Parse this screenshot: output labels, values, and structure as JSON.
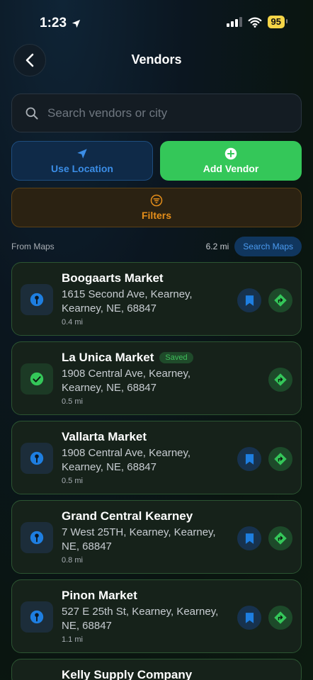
{
  "status": {
    "time": "1:23",
    "battery": "95"
  },
  "header": {
    "title": "Vendors"
  },
  "search": {
    "placeholder": "Search vendors or city"
  },
  "actions": {
    "use_location": "Use Location",
    "add_vendor": "Add Vendor",
    "filters": "Filters"
  },
  "section": {
    "label": "From Maps",
    "distance": "6.2 mi",
    "search_maps": "Search Maps"
  },
  "vendors": [
    {
      "name": "Boogaarts Market",
      "address": "1615 Second Ave, Kearney, Kearney, NE, 68847",
      "distance": "0.4 mi",
      "saved": false
    },
    {
      "name": "La Unica Market",
      "badge": "Saved",
      "address": "1908 Central Ave, Kearney, Kearney, NE, 68847",
      "distance": "0.5 mi",
      "saved": true
    },
    {
      "name": "Vallarta Market",
      "address": "1908 Central Ave, Kearney, Kearney, NE, 68847",
      "distance": "0.5 mi",
      "saved": false
    },
    {
      "name": "Grand Central Kearney",
      "address": "7 West 25TH, Kearney, Kearney, NE, 68847",
      "distance": "0.8 mi",
      "saved": false
    },
    {
      "name": "Pinon Market",
      "address": "527 E 25th St, Kearney, Kearney, NE, 68847",
      "distance": "1.1 mi",
      "saved": false
    },
    {
      "name": "Kelly Supply Company"
    }
  ],
  "colors": {
    "accent_green": "#34c759",
    "accent_blue": "#1e7ee0",
    "accent_orange": "#e58e1a"
  }
}
